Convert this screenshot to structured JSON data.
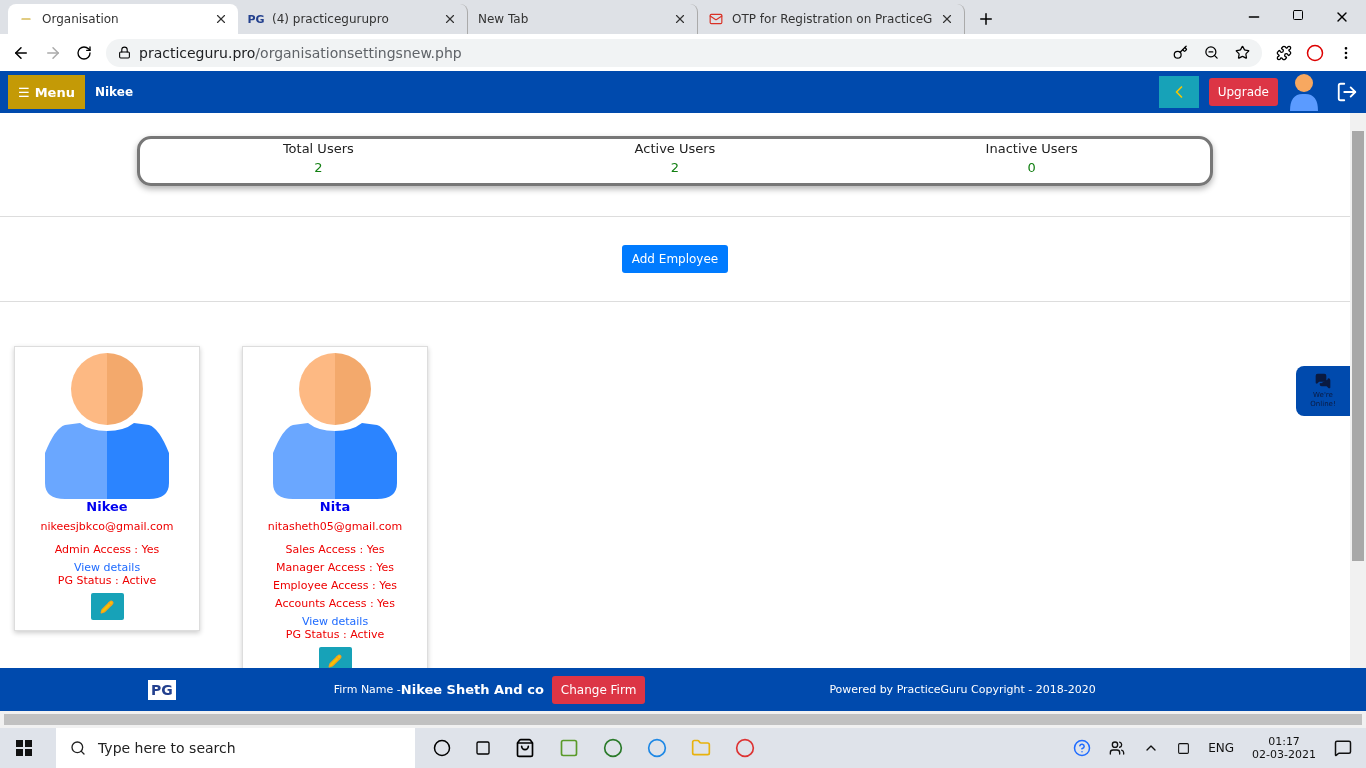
{
  "browser": {
    "tabs": [
      {
        "title": "Organisation",
        "kind": "dash",
        "selected": true
      },
      {
        "title": "(4) practicegurupro",
        "kind": "pg",
        "favicon_text": "PG",
        "selected": false
      },
      {
        "title": "New Tab",
        "kind": "none",
        "selected": false
      },
      {
        "title": "OTP for Registration on PracticeG",
        "kind": "mail",
        "selected": false
      }
    ],
    "url_host": "practiceguru.pro",
    "url_path": "/organisationsettingsnew.php"
  },
  "navbar": {
    "menu_icon": "☰",
    "menu_label": "Menu",
    "user": "Nikee",
    "upgrade": "Upgrade"
  },
  "stats": [
    {
      "label": "Total Users",
      "value": "2"
    },
    {
      "label": "Active Users",
      "value": "2"
    },
    {
      "label": "Inactive Users",
      "value": "0"
    }
  ],
  "add_button": "Add Employee",
  "employees": [
    {
      "name": "Nikee",
      "email": "nikeesjbkco@gmail.com",
      "access": [
        "Admin Access : Yes"
      ],
      "link": "View details",
      "status": "PG Status : Active"
    },
    {
      "name": "Nita",
      "email": "nitasheth05@gmail.com",
      "access": [
        "Sales Access : Yes",
        "Manager Access : Yes",
        "Employee Access : Yes",
        "Accounts Access : Yes"
      ],
      "link": "View details",
      "status": "PG Status : Active"
    }
  ],
  "chat": {
    "label": "We're Online!"
  },
  "footer": {
    "logo": "PG",
    "firm_label": "Firm Name -",
    "firm_name": "Nikee Sheth And co",
    "change": "Change Firm",
    "powered": "Powered by PracticeGuru Copyright - 2018-2020"
  },
  "taskbar": {
    "search_placeholder": "Type here to search",
    "language": "ENG",
    "time": "01:17",
    "date": "02-03-2021"
  }
}
